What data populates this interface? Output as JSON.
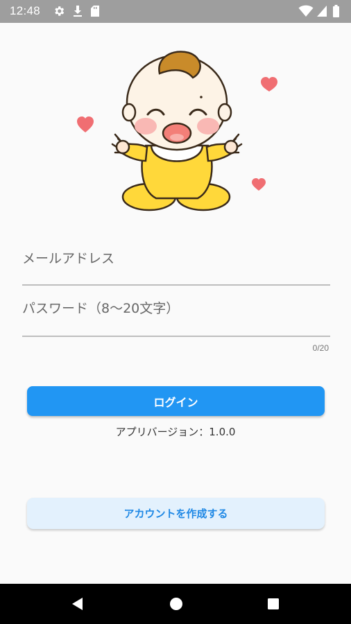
{
  "status_bar": {
    "time": "12:48",
    "left_icons": [
      "gear-icon",
      "download-icon",
      "sd-card-icon"
    ],
    "right_icons": [
      "wifi-icon",
      "signal-icon",
      "battery-icon"
    ]
  },
  "form": {
    "email_placeholder": "メールアドレス",
    "password_placeholder": "パスワード（8〜20文字）",
    "password_counter": "0/20"
  },
  "actions": {
    "login_label": "ログイン",
    "version_text": "アプリバージョン：1.0.0",
    "create_account_label": "アカウントを作成する"
  },
  "colors": {
    "primary": "#2196f3",
    "secondary_bg": "#e3f1fd",
    "secondary_text": "#1e88e5",
    "status_bar": "#9e9e9e",
    "background": "#fafafa"
  },
  "nav_bar": {
    "icons": [
      "back-icon",
      "home-icon",
      "recents-icon"
    ]
  }
}
